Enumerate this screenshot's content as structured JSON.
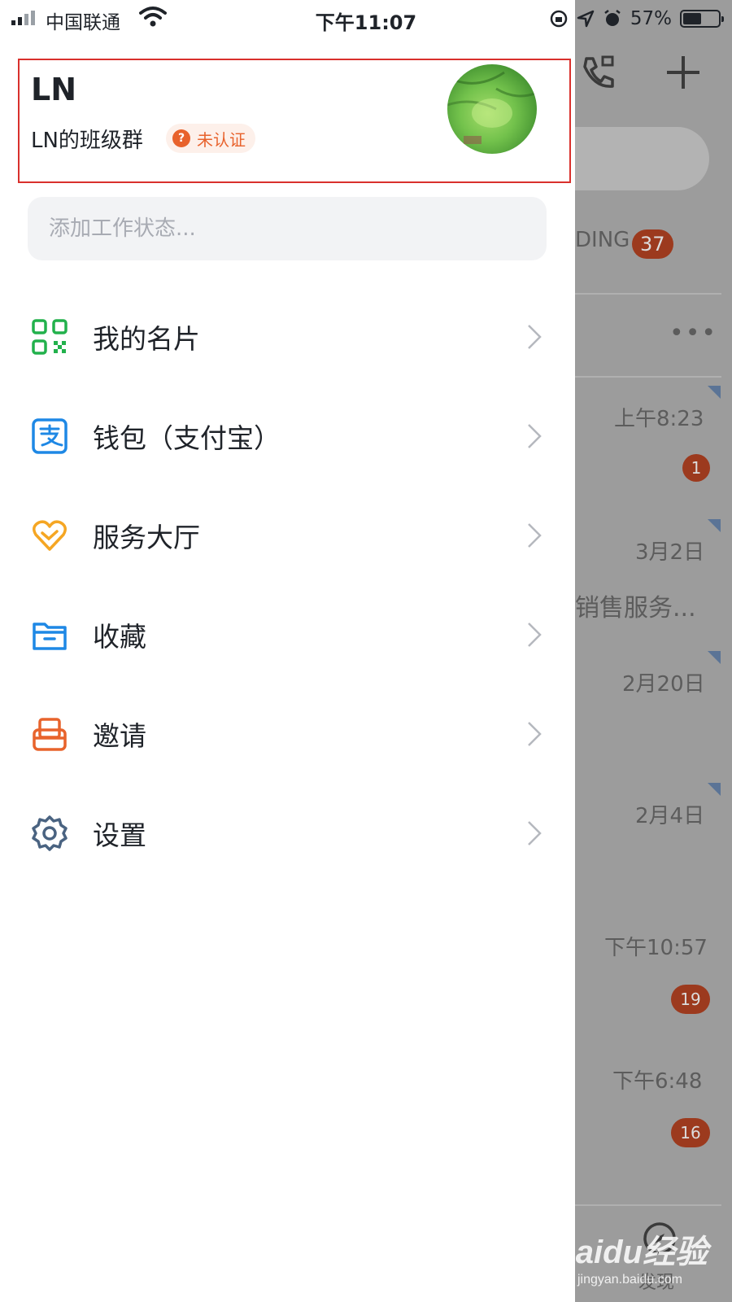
{
  "status_bar": {
    "carrier": "中国联通",
    "time": "下午11:07",
    "battery": "57%",
    "battery_level": 0.57
  },
  "profile": {
    "name": "LN",
    "org": "LN的班级群",
    "cert_status": "未认证"
  },
  "status_input": {
    "placeholder": "添加工作状态..."
  },
  "menu": [
    {
      "label": "我的名片",
      "icon": "qr-code-icon",
      "color": "#22b14c"
    },
    {
      "label": "钱包（支付宝）",
      "icon": "alipay-icon",
      "color": "#1e88e5"
    },
    {
      "label": "服务大厅",
      "icon": "heart-hands-icon",
      "color": "#f5a623"
    },
    {
      "label": "收藏",
      "icon": "folder-icon",
      "color": "#1e88e5"
    },
    {
      "label": "邀请",
      "icon": "invite-icon",
      "color": "#e8632c"
    },
    {
      "label": "设置",
      "icon": "gear-icon",
      "color": "#4a6381"
    }
  ],
  "background": {
    "ding_label": "DING",
    "ding_count": "37",
    "items": [
      {
        "time": "上午8:23",
        "badge": "1"
      },
      {
        "time": "3月2日",
        "snippet": "销售服务..."
      },
      {
        "time": "2月20日"
      },
      {
        "time": "2月4日"
      },
      {
        "time": "下午10:57",
        "badge": "19"
      },
      {
        "time": "下午6:48",
        "badge": "16"
      }
    ],
    "nav_label": "发现"
  },
  "watermark": {
    "logo": "Baidu经验",
    "url": "jingyan.baidu.com"
  }
}
